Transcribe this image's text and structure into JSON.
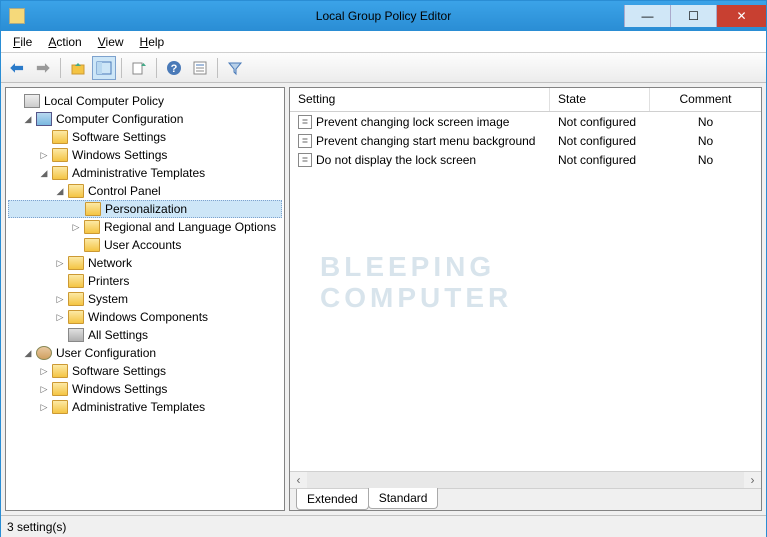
{
  "window": {
    "title": "Local Group Policy Editor"
  },
  "menus": {
    "file": "File",
    "action": "Action",
    "view": "View",
    "help": "Help"
  },
  "tree": {
    "root": "Local Computer Policy",
    "computer_config": "Computer Configuration",
    "cc_software": "Software Settings",
    "cc_windows": "Windows Settings",
    "cc_admin": "Administrative Templates",
    "cc_control_panel": "Control Panel",
    "cc_personalization": "Personalization",
    "cc_regional": "Regional and Language Options",
    "cc_user_accounts": "User Accounts",
    "cc_network": "Network",
    "cc_printers": "Printers",
    "cc_system": "System",
    "cc_windows_comp": "Windows Components",
    "cc_all_settings": "All Settings",
    "user_config": "User Configuration",
    "uc_software": "Software Settings",
    "uc_windows": "Windows Settings",
    "uc_admin": "Administrative Templates"
  },
  "columns": {
    "setting": "Setting",
    "state": "State",
    "comment": "Comment"
  },
  "settings": [
    {
      "name": "Prevent changing lock screen image",
      "state": "Not configured",
      "comment": "No"
    },
    {
      "name": "Prevent changing start menu background",
      "state": "Not configured",
      "comment": "No"
    },
    {
      "name": "Do not display the lock screen",
      "state": "Not configured",
      "comment": "No"
    }
  ],
  "tabs": {
    "extended": "Extended",
    "standard": "Standard"
  },
  "status": "3 setting(s)",
  "watermark": {
    "line1": "BLEEPING",
    "line2": "COMPUTER"
  }
}
